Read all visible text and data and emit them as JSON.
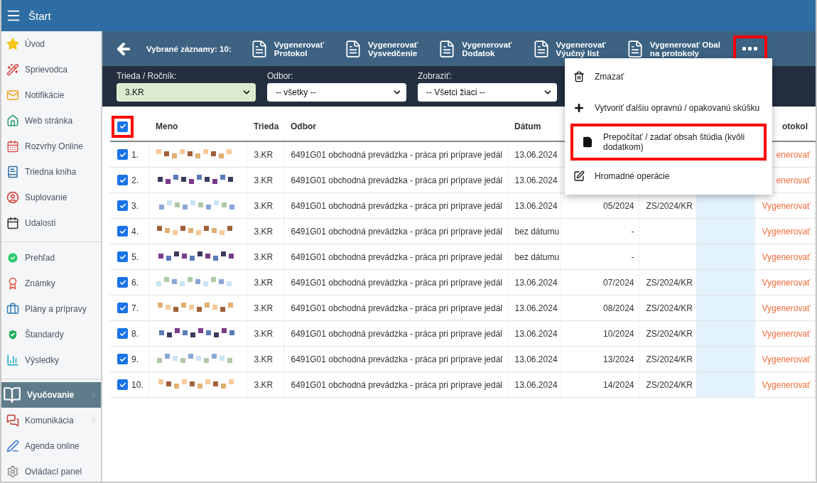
{
  "header": {
    "title": "Štart"
  },
  "sidebar": {
    "groups": [
      [
        {
          "label": "Úvod",
          "selected": false,
          "expandable": false
        },
        {
          "label": "Sprievodca",
          "selected": false,
          "expandable": false
        },
        {
          "label": "Notifikácie",
          "selected": false,
          "expandable": false
        },
        {
          "label": "Web stránka",
          "selected": false,
          "expandable": false
        },
        {
          "label": "Rozvrhy Online",
          "selected": false,
          "expandable": false
        },
        {
          "label": "Triedna kniha",
          "selected": false,
          "expandable": false
        },
        {
          "label": "Suplovanie",
          "selected": false,
          "expandable": false
        },
        {
          "label": "Udalosti",
          "selected": false,
          "expandable": false
        }
      ],
      [
        {
          "label": "Prehľad",
          "selected": false,
          "expandable": false
        },
        {
          "label": "Známky",
          "selected": false,
          "expandable": false
        },
        {
          "label": "Plány a prípravy",
          "selected": false,
          "expandable": false
        },
        {
          "label": "Štandardy",
          "selected": false,
          "expandable": false
        },
        {
          "label": "Výsledky",
          "selected": false,
          "expandable": false
        }
      ],
      [
        {
          "label": "Vyučovanie",
          "selected": true,
          "expandable": true
        },
        {
          "label": "Komunikácia",
          "selected": false,
          "expandable": true
        },
        {
          "label": "Agenda online",
          "selected": false,
          "expandable": false
        },
        {
          "label": "Ovládací panel",
          "selected": false,
          "expandable": false
        }
      ]
    ]
  },
  "toolbar": {
    "selected_count": "Vybrané záznamy: 10:",
    "actions": [
      {
        "lines": [
          "Vygenerovať",
          "Protokol"
        ]
      },
      {
        "lines": [
          "Vygenerovať",
          "Vysvedčenie"
        ]
      },
      {
        "lines": [
          "Vygenerovať",
          "Dodatok"
        ]
      },
      {
        "lines": [
          "Vygenerovať",
          "Výučný list"
        ]
      },
      {
        "lines": [
          "Vygenerovať Obal",
          "na protokoly"
        ]
      }
    ],
    "more_button": {
      "highlighted": true
    }
  },
  "filters": [
    {
      "label": "Trieda / Ročník:",
      "value": "3.KR",
      "active": true
    },
    {
      "label": "Odbor:",
      "value": "-- všetky --",
      "active": false
    },
    {
      "label": "Zobraziť:",
      "value": "-- Všetci žiaci --",
      "active": false
    }
  ],
  "table": {
    "header_checkbox": {
      "checked": true,
      "highlighted": true
    },
    "header": {
      "meno": "Meno",
      "trieda": "Trieda",
      "odbor": "Odbor",
      "datum": "Dátum",
      "protokol": "otokol"
    },
    "rows": [
      {
        "number": "1.",
        "checked": true,
        "trieda": "3.KR",
        "odbor": "6491G01 obchodná prevádzka - práca pri príprave jedál",
        "datum": "13.06.2024",
        "protokol": "enerovať"
      },
      {
        "number": "2.",
        "checked": true,
        "trieda": "3.KR",
        "odbor": "6491G01 obchodná prevádzka - práca pri príprave jedál",
        "datum": "13.06.2024",
        "protokol": "enerovať"
      },
      {
        "number": "3.",
        "checked": true,
        "trieda": "3.KR",
        "odbor": "6491G01 obchodná prevádzka - práca pri príprave jedál",
        "datum": "13.06.2024",
        "cislo": "05/2024",
        "kod": "ZS/2024/KR",
        "protokol": "Vygenerovať"
      },
      {
        "number": "4.",
        "checked": true,
        "trieda": "3.KR",
        "odbor": "6491G01 obchodná prevádzka - práca pri príprave jedál",
        "datum": "bez dátumu",
        "cislo": "-",
        "protokol": "Vygenerovať"
      },
      {
        "number": "5.",
        "checked": true,
        "trieda": "3.KR",
        "odbor": "6491G01 obchodná prevádzka - práca pri príprave jedál",
        "datum": "bez dátumu",
        "cislo": "-",
        "protokol": "Vygenerovať"
      },
      {
        "number": "6.",
        "checked": true,
        "trieda": "3.KR",
        "odbor": "6491G01 obchodná prevádzka - práca pri príprave jedál",
        "datum": "13.06.2024",
        "cislo": "07/2024",
        "kod": "ZS/2024/KR",
        "protokol": "Vygenerovať"
      },
      {
        "number": "7.",
        "checked": true,
        "trieda": "3.KR",
        "odbor": "6491G01 obchodná prevádzka - práca pri príprave jedál",
        "datum": "13.06.2024",
        "cislo": "08/2024",
        "kod": "ZS/2024/KR",
        "protokol": "Vygenerovať"
      },
      {
        "number": "8.",
        "checked": true,
        "trieda": "3.KR",
        "odbor": "6491G01 obchodná prevádzka - práca pri príprave jedál",
        "datum": "13.06.2024",
        "cislo": "10/2024",
        "kod": "ZS/2024/KR",
        "protokol": "Vygenerovať"
      },
      {
        "number": "9.",
        "checked": true,
        "trieda": "3.KR",
        "odbor": "6491G01 obchodná prevádzka - práca pri príprave jedál",
        "datum": "13.06.2024",
        "cislo": "13/2024",
        "kod": "ZS/2024/KR",
        "protokol": "Vygenerovať"
      },
      {
        "number": "10.",
        "checked": true,
        "trieda": "3.KR",
        "odbor": "6491G01 obchodná prevádzka - práca pri príprave jedál",
        "datum": "13.06.2024",
        "cislo": "14/2024",
        "kod": "ZS/2024/KR",
        "protokol": "Vygenerovať"
      }
    ]
  },
  "menu": {
    "items": [
      {
        "kind": "delete",
        "label": "Zmazať",
        "highlighted": false
      },
      {
        "kind": "add",
        "label": "Vytvoriť ďalšiu opravnú / opakovanú skúšku",
        "highlighted": false
      },
      {
        "kind": "file",
        "label": "Prepočítať / zadať obsah štúdia (kvôli dodatkom)",
        "highlighted": true
      },
      {
        "kind": "edit",
        "label": "Hromadné operácie",
        "highlighted": false
      }
    ]
  }
}
